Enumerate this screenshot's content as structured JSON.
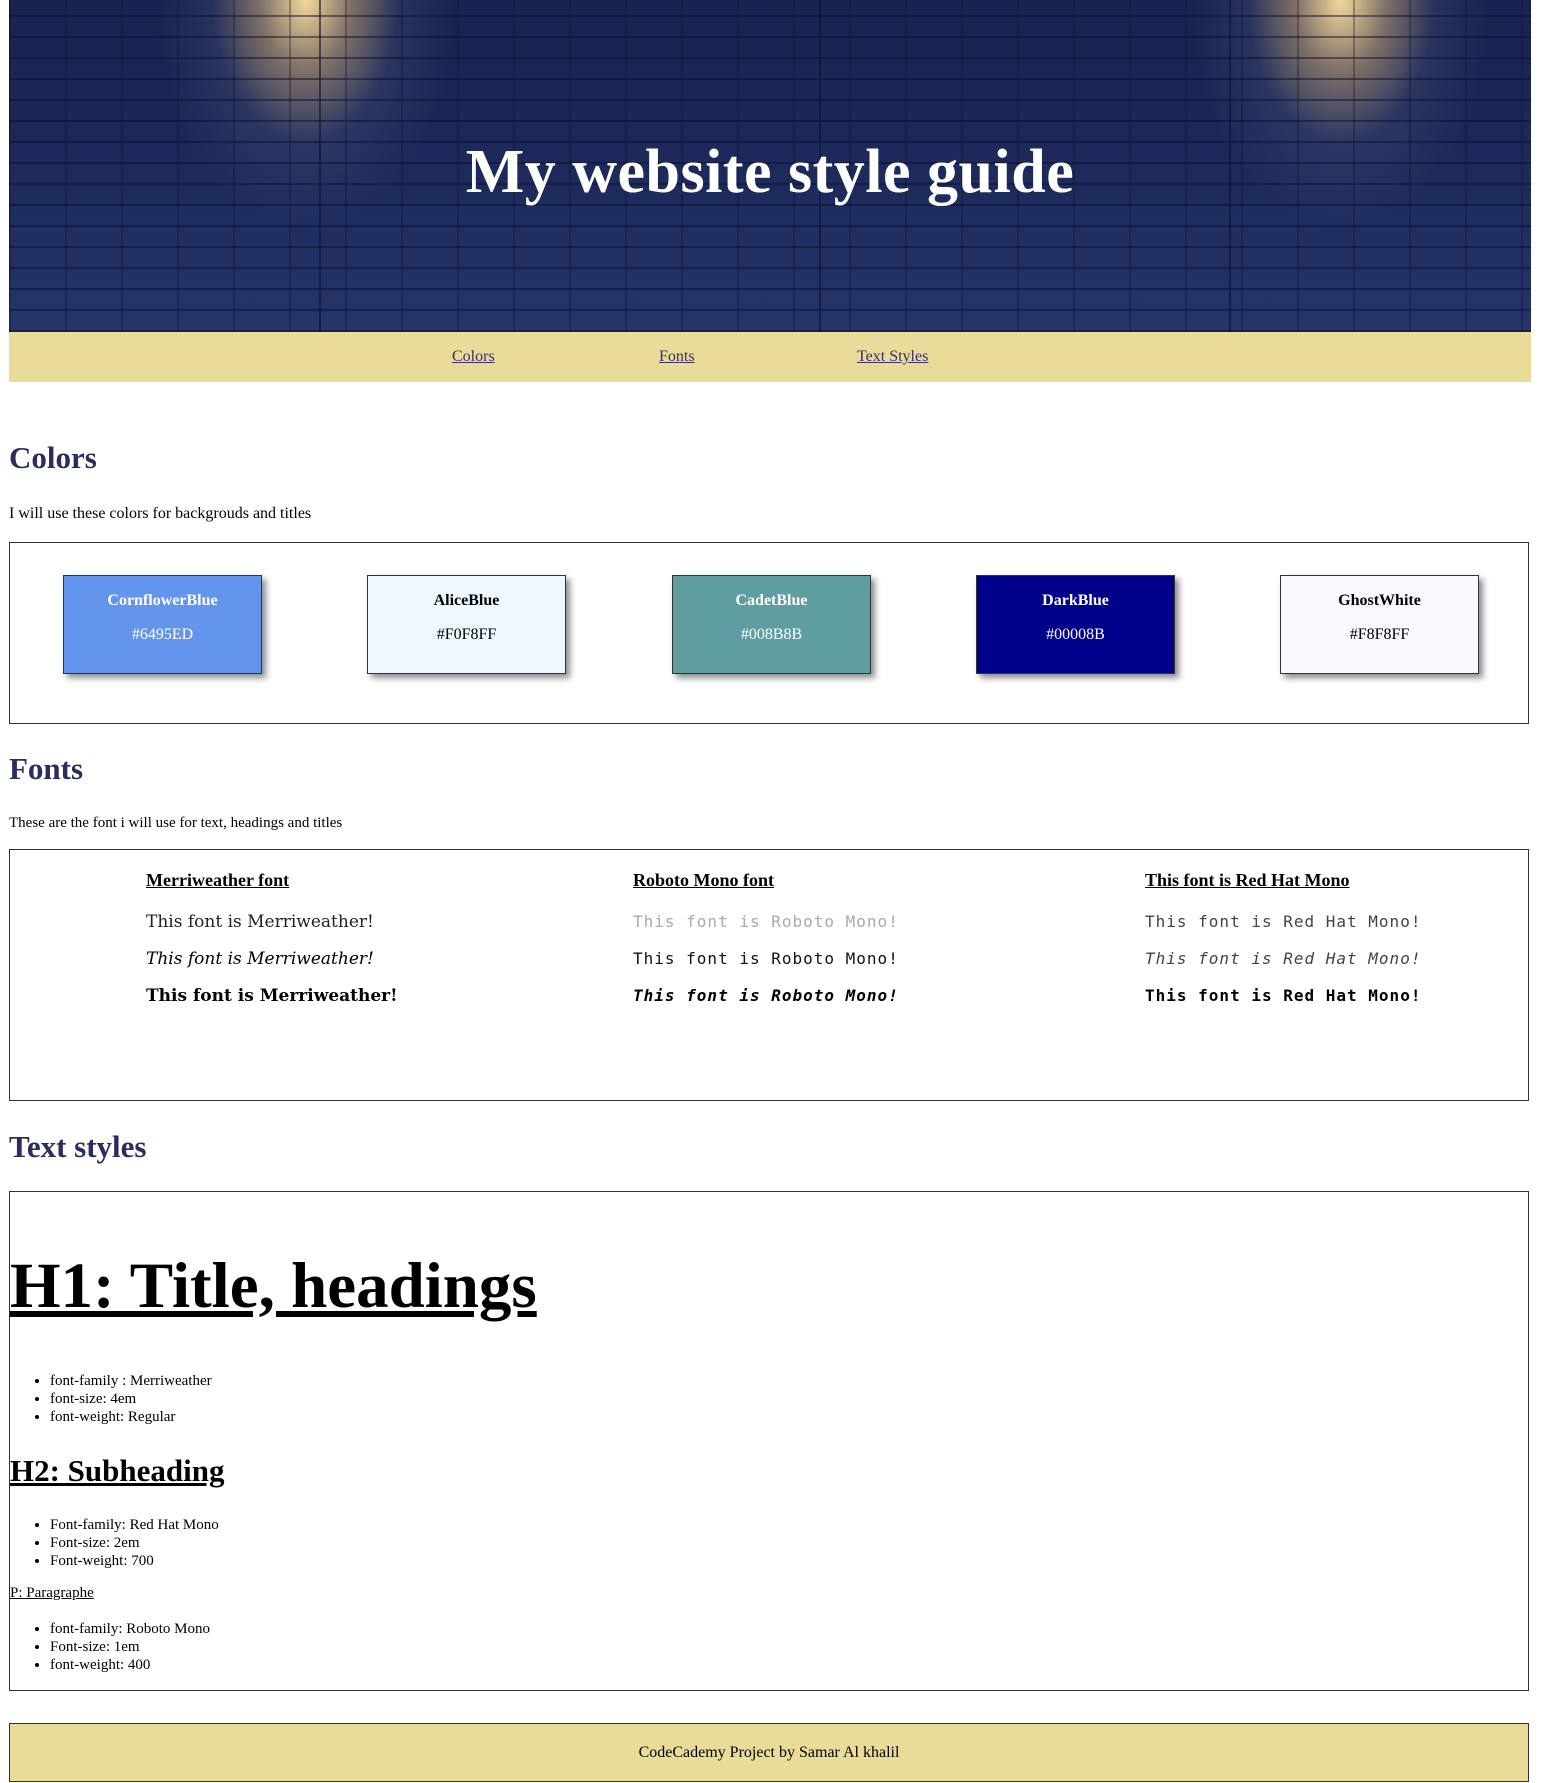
{
  "header": {
    "title": "My website style guide"
  },
  "nav": {
    "items": [
      {
        "label": "Colors"
      },
      {
        "label": "Fonts"
      },
      {
        "label": "Text Styles"
      }
    ],
    "link_color": "#3a2d6b"
  },
  "colors_section": {
    "title": "Colors",
    "description": "I will use these colors for backgrouds and titles",
    "swatches": [
      {
        "name": "CornflowerBlue",
        "hex": "#6495ED",
        "text_color": "#ffffff"
      },
      {
        "name": "AliceBlue",
        "hex": "#F0F8FF",
        "text_color": "#000000"
      },
      {
        "name": "CadetBlue",
        "hex": "#008B8B",
        "text_color": "#ffffff"
      },
      {
        "name": "DarkBlue",
        "hex": "#00008B",
        "text_color": "#ffffff"
      },
      {
        "name": "GhostWhite",
        "hex": "#F8F8FF",
        "text_color": "#000000"
      }
    ]
  },
  "fonts_section": {
    "title": "Fonts",
    "description": "These are the font i will use for text, headings and titles",
    "columns": [
      {
        "heading": "Merriweather font",
        "samples": [
          "This font is Merriweather!",
          "This font is Merriweather!",
          "This font is Merriweather!"
        ]
      },
      {
        "heading": "Roboto Mono font",
        "samples": [
          "This font is Roboto Mono!",
          "This font is Roboto Mono!",
          "This font is Roboto Mono!"
        ]
      },
      {
        "heading": "This font is Red Hat Mono",
        "samples": [
          "This font is Red Hat Mono!",
          "This font is Red Hat Mono!",
          "This font is Red Hat Mono!"
        ]
      }
    ]
  },
  "text_styles_section": {
    "title": "Text styles",
    "h1": {
      "label": "H1: Title, headings",
      "specs": [
        "font-family : Merriweather",
        "font-size: 4em",
        "font-weight: Regular"
      ]
    },
    "h2": {
      "label": "H2: Subheading",
      "specs": [
        "Font-family: Red Hat Mono",
        "Font-size: 2em",
        "Font-weight: 700"
      ]
    },
    "p": {
      "label": "P: Paragraphe",
      "specs": [
        "font-family: Roboto Mono",
        "Font-size: 1em",
        "font-weight: 400"
      ]
    }
  },
  "footer": {
    "text": "CodeCademy Project by Samar Al khalil"
  },
  "theme": {
    "accent_yellow": "#e8dc98",
    "heading_color": "#2b2d5e"
  }
}
